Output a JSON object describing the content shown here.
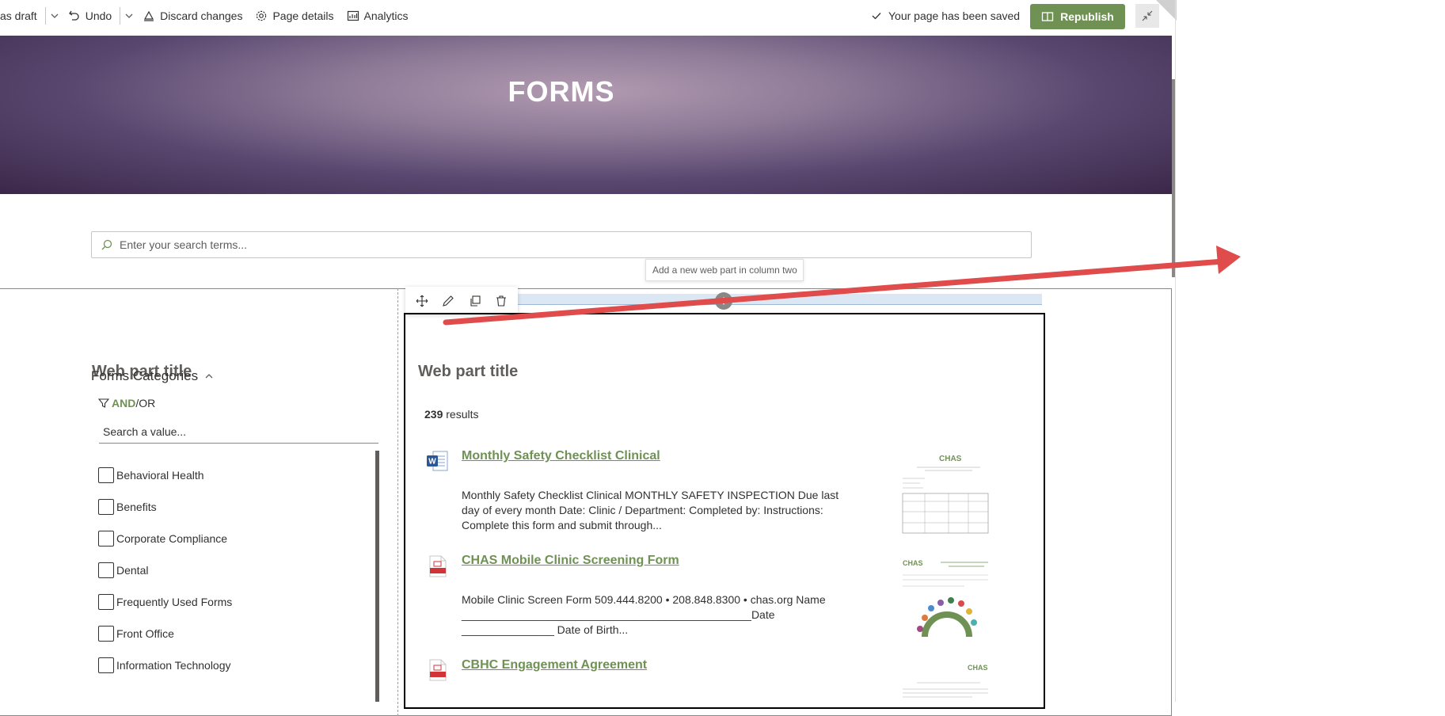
{
  "toolbar": {
    "save_draft": "as draft",
    "undo": "Undo",
    "discard": "Discard changes",
    "page_details": "Page details",
    "analytics": "Analytics",
    "saved_status": "Your page has been saved",
    "republish": "Republish"
  },
  "page": {
    "hero_title": "FORMS",
    "search_placeholder": "Enter your search terms..."
  },
  "section_tooltip": "Add a new web part in column two",
  "left_webpart": {
    "title": "Web part title",
    "filter_title": "Forms Categories",
    "and_label": "AND",
    "or_label": "/OR",
    "value_search": "Search a value...",
    "categories": [
      "Behavioral Health",
      "Benefits",
      "Corporate Compliance",
      "Dental",
      "Frequently Used Forms",
      "Front Office",
      "Information Technology"
    ]
  },
  "right_webpart": {
    "title": "Web part title",
    "count": "239",
    "count_suffix": " results",
    "results": [
      {
        "title": "Monthly Safety Checklist Clinical",
        "snippet": "Monthly Safety Checklist Clinical MONTHLY SAFETY INSPECTION Due last day of every month Date: Clinic / Department: Completed by: Instructions: Complete this form and submit through...",
        "file_icon": "word-doc-icon"
      },
      {
        "title": "CHAS Mobile Clinic Screening Form",
        "snippet": "Mobile Clinic Screen Form 509.444.8200 • 208.848.8300 • chas.org Name _______________________________________________Date _______________ Date of Birth...",
        "file_icon": "pdf-icon"
      },
      {
        "title": "CBHC Engagement Agreement",
        "snippet": "",
        "file_icon": "pdf-icon"
      }
    ]
  },
  "colors": {
    "accent_green": "#6f9254",
    "annotation_red": "#e04b4b"
  }
}
